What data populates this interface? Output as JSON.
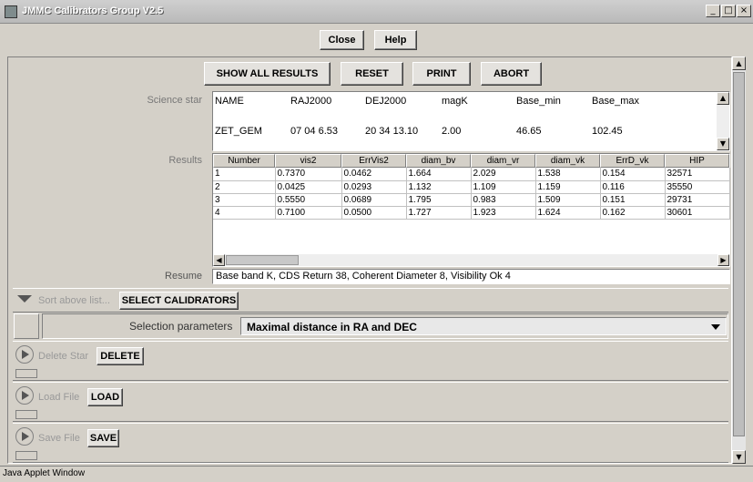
{
  "window": {
    "title": "JMMC Calibrators Group V2.5",
    "min": "_",
    "max": "□",
    "close": "×"
  },
  "top_buttons": {
    "close": "Close",
    "help": "Help"
  },
  "actions": {
    "show_all": "SHOW ALL RESULTS",
    "reset": "RESET",
    "print": "PRINT",
    "abort": "ABORT"
  },
  "science_star": {
    "label": "Science star",
    "headers": [
      "NAME",
      "RAJ2000",
      "DEJ2000",
      "magK",
      "Base_min",
      "Base_max"
    ],
    "values": [
      "ZET_GEM",
      "07 04 6.53",
      "20 34 13.10",
      "2.00",
      "46.65",
      "102.45"
    ]
  },
  "results": {
    "label": "Results",
    "columns": [
      "Number",
      "vis2",
      "ErrVis2",
      "diam_bv",
      "diam_vr",
      "diam_vk",
      "ErrD_vk",
      "HIP"
    ],
    "rows": [
      [
        "1",
        "0.7370",
        "0.0462",
        "1.664",
        "2.029",
        "1.538",
        "0.154",
        "32571"
      ],
      [
        "2",
        "0.0425",
        "0.0293",
        "1.132",
        "1.109",
        "1.159",
        "0.116",
        "35550"
      ],
      [
        "3",
        "0.5550",
        "0.0689",
        "1.795",
        "0.983",
        "1.509",
        "0.151",
        "29731"
      ],
      [
        "4",
        "0.7100",
        "0.0500",
        "1.727",
        "1.923",
        "1.624",
        "0.162",
        "30601"
      ]
    ]
  },
  "resume": {
    "label": "Resume",
    "value": "Base band K,  CDS Return 38, Coherent Diameter 8, Visibility Ok 4"
  },
  "sort": {
    "label": "Sort above list...",
    "button": "SELECT CALIDRATORS"
  },
  "selection": {
    "label": "Selection parameters",
    "value": "Maximal distance in RA and DEC"
  },
  "delete": {
    "label": "Delete Star",
    "button": "DELETE"
  },
  "load": {
    "label": "Load File",
    "button": "LOAD"
  },
  "save": {
    "label": "Save File",
    "button": "SAVE"
  },
  "status": {
    "text": "Java Applet Window"
  }
}
